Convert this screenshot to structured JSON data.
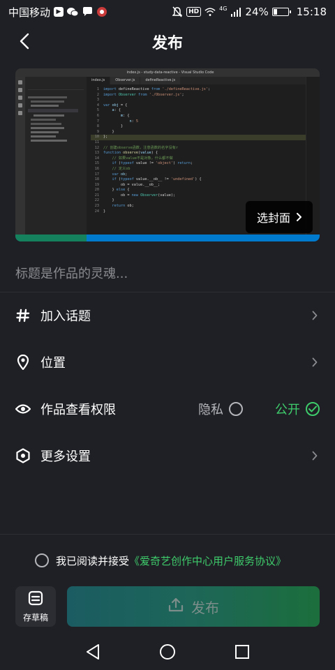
{
  "status_bar": {
    "carrier": "中国移动",
    "network_badge": "4G",
    "hd_badge": "HD",
    "battery_percent": "24%",
    "time": "15:18"
  },
  "header": {
    "title": "发布"
  },
  "cover": {
    "select_cover_label": "选封面",
    "editor_title": "index.js - study-data-reactive - Visual Studio Code",
    "tabs": [
      "index.js",
      "Observer.js",
      "defineReactive.js"
    ]
  },
  "title_input": {
    "placeholder": "标题是作品的灵魂..."
  },
  "menu": {
    "topic_label": "加入话题",
    "location_label": "位置",
    "permission_label": "作品查看权限",
    "permission_private": "隐私",
    "permission_public": "公开",
    "permission_selected": "公开",
    "more_settings_label": "更多设置"
  },
  "agreement": {
    "prefix": "我已阅读并接受",
    "link": "《爱奇艺创作中心用户服务协议》"
  },
  "actions": {
    "draft_label": "存草稿",
    "publish_label": "发布"
  },
  "colors": {
    "background": "#1f2025",
    "accent_green": "#3ecb6b",
    "text_muted": "#8a8b90"
  }
}
